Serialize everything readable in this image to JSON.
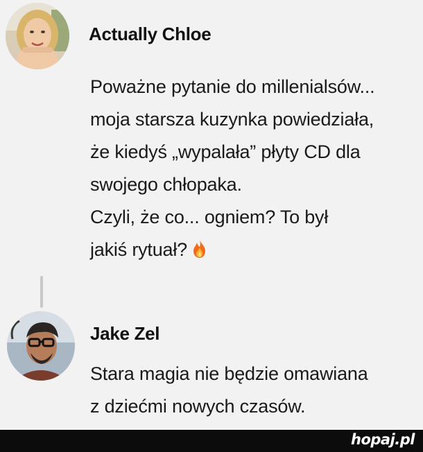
{
  "post": {
    "author": "Actually Chloe",
    "avatar_icon": "user-avatar-blonde-woman",
    "message_lines": [
      "Poważne pytanie do millenialsów...",
      "moja starsza kuzynka powiedziała,",
      "że kiedyś „wypalała” płyty CD dla",
      "swojego chłopaka.",
      "Czyli, że co... ogniem? To był",
      "jakiś rytuał?"
    ],
    "emoji": "fire-icon"
  },
  "reply": {
    "author": "Jake Zel",
    "avatar_icon": "user-avatar-man-glasses",
    "message_lines": [
      "Stara magia nie będzie omawiana",
      "z dziećmi nowych czasów."
    ]
  },
  "footer": {
    "brand": "hopaj.pl"
  },
  "colors": {
    "background": "#f2f2f2",
    "text": "#1a1a1a",
    "footer": "#0c0c0c"
  }
}
